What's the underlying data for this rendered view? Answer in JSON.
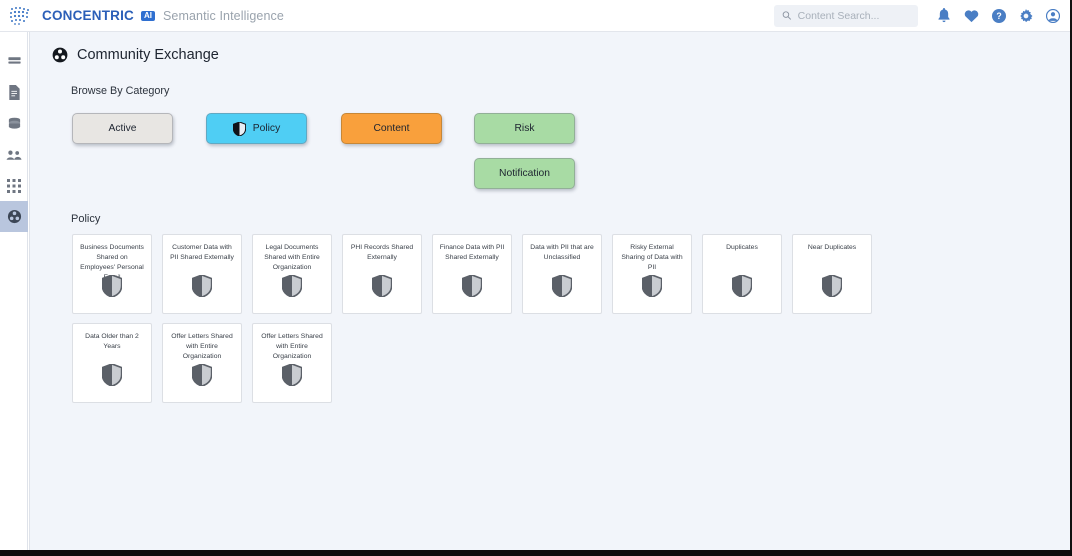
{
  "header": {
    "brand_name": "CONCENTRIC",
    "ai_badge": "AI",
    "brand_tagline": "Semantic Intelligence",
    "search_placeholder": "Content Search...",
    "search_value": "",
    "icons": [
      {
        "name": "bell-icon",
        "label": "Notifications"
      },
      {
        "name": "heart-icon",
        "label": "Favorites"
      },
      {
        "name": "help-icon",
        "label": "Help"
      },
      {
        "name": "gear-icon",
        "label": "Settings"
      },
      {
        "name": "account-icon",
        "label": "Account"
      }
    ]
  },
  "sidebar": {
    "items": [
      {
        "name": "sidebar-item-dashboard",
        "icon": "dashboard-icon",
        "active": false
      },
      {
        "name": "sidebar-item-documents",
        "icon": "document-icon",
        "active": false
      },
      {
        "name": "sidebar-item-data",
        "icon": "database-icon",
        "active": false
      },
      {
        "name": "sidebar-item-users",
        "icon": "people-icon",
        "active": false
      },
      {
        "name": "sidebar-item-apps",
        "icon": "grid-icon",
        "active": false
      },
      {
        "name": "sidebar-item-community-exchange",
        "icon": "globe-icon",
        "active": true
      }
    ]
  },
  "page": {
    "title": "Community Exchange",
    "title_icon": "globe-icon",
    "browse_label": "Browse By Category",
    "grid_section_title": "Policy"
  },
  "categories": [
    {
      "label": "Active",
      "color": "#e8e6e3",
      "icon": null,
      "selected": false
    },
    {
      "label": "Policy",
      "color": "#4fcef4",
      "icon": "shield-icon",
      "selected": true
    },
    {
      "label": "Content",
      "color": "#f9a03c",
      "icon": null,
      "selected": false
    },
    {
      "label": "Risk",
      "color": "#a8dba4",
      "icon": null,
      "selected": false
    },
    {
      "label": "Notification",
      "color": "#a8dba4",
      "icon": null,
      "selected": false
    }
  ],
  "cards": [
    {
      "title": "Business Documents Shared on Employees' Personal Email",
      "icon": "shield-icon"
    },
    {
      "title": "Customer Data with PII Shared Externally",
      "icon": "shield-icon"
    },
    {
      "title": "Legal Documents Shared with Entire Organization",
      "icon": "shield-icon"
    },
    {
      "title": "PHI Records Shared Externally",
      "icon": "shield-icon"
    },
    {
      "title": "Finance Data with PII Shared Externally",
      "icon": "shield-icon"
    },
    {
      "title": "Data with PII that are Unclassified",
      "icon": "shield-icon"
    },
    {
      "title": "Risky External Sharing of Data with PII",
      "icon": "shield-icon"
    },
    {
      "title": "Duplicates",
      "icon": "shield-icon"
    },
    {
      "title": "Near Duplicates",
      "icon": "shield-icon"
    },
    {
      "title": "Data Older than 2 Years",
      "icon": "shield-icon"
    },
    {
      "title": "Offer Letters Shared with Entire Organization",
      "icon": "shield-icon"
    },
    {
      "title": "Offer Letters Shared with Entire Organization",
      "icon": "shield-icon"
    }
  ]
}
